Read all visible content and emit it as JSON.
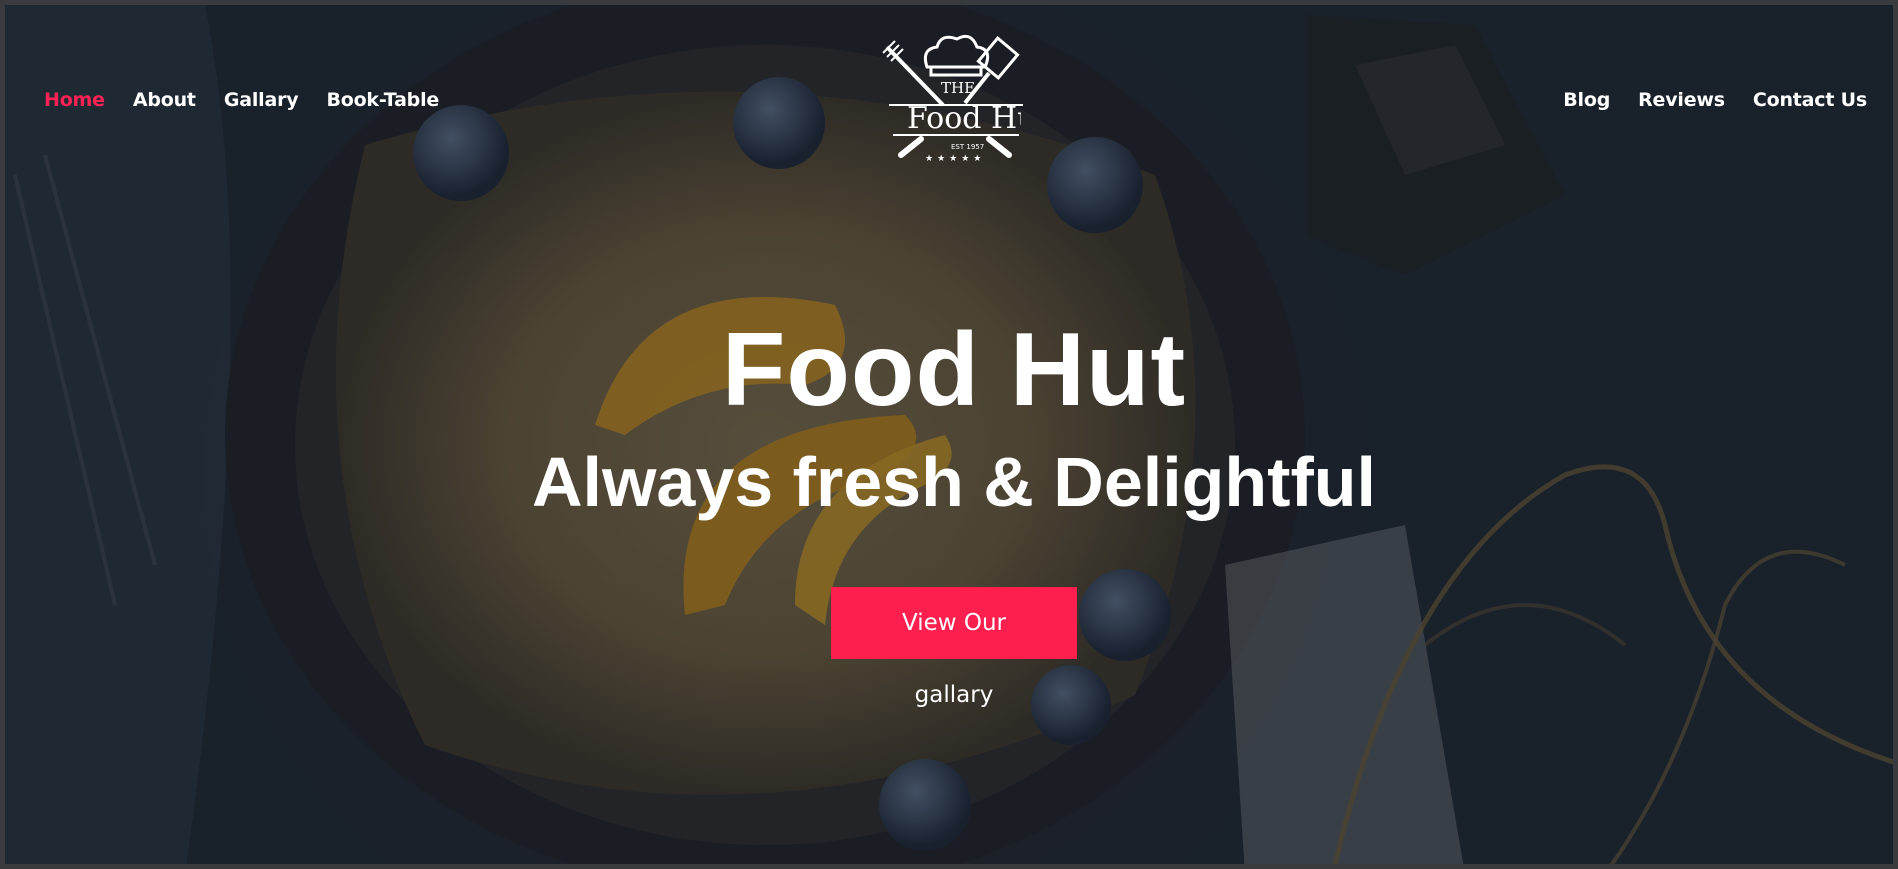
{
  "nav": {
    "left_items": [
      {
        "label": "Home",
        "active": true
      },
      {
        "label": "About",
        "active": false
      },
      {
        "label": "Gallary",
        "active": false
      },
      {
        "label": "Book-Table",
        "active": false
      }
    ],
    "right_items": [
      {
        "label": "Blog",
        "active": false
      },
      {
        "label": "Reviews",
        "active": false
      },
      {
        "label": "Contact Us",
        "active": false
      }
    ],
    "active_color": "#ff2255"
  },
  "logo": {
    "the": "THE",
    "name": "Food Hut",
    "est": "EST 1957",
    "stars": "★★★★★",
    "icon": "chef-hat-fork-spatula-icon"
  },
  "hero": {
    "title": "Food Hut",
    "subtitle": "Always fresh & Delightful",
    "button_label": "View Our gallary",
    "button_color": "#ff1f4f"
  }
}
